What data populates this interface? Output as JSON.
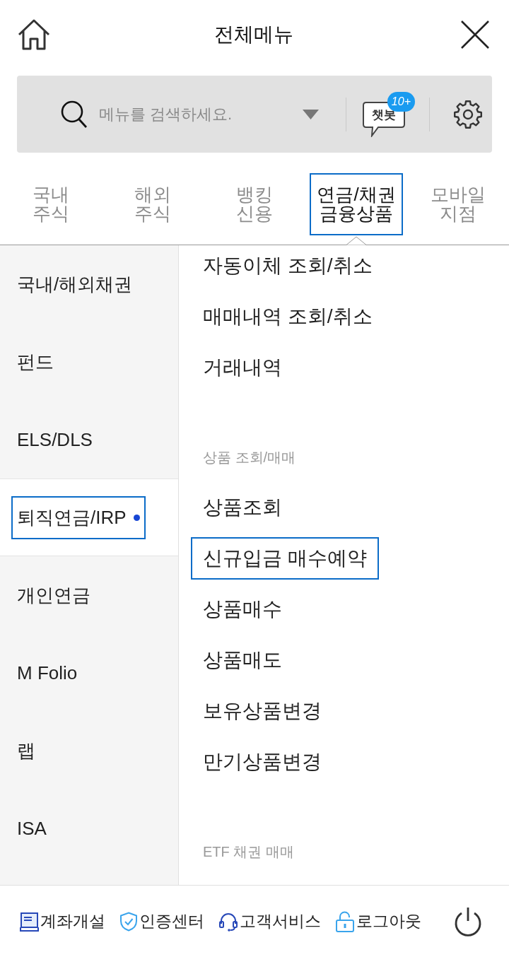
{
  "header": {
    "title": "전체메뉴"
  },
  "search": {
    "placeholder": "메뉴를 검색하세요.",
    "chatbot": {
      "label": "챗봇",
      "badge": "10+"
    }
  },
  "tabs": [
    {
      "label": "국내\n주식",
      "selected": false,
      "highlighted": false
    },
    {
      "label": "해외\n주식",
      "selected": false,
      "highlighted": false
    },
    {
      "label": "뱅킹\n신용",
      "selected": false,
      "highlighted": false
    },
    {
      "label": "연금/채권\n금융상품",
      "selected": true,
      "highlighted": true
    },
    {
      "label": "모바일\n지점",
      "selected": false,
      "highlighted": false
    }
  ],
  "sidebar": {
    "items": [
      {
        "label": "국내/해외채권",
        "selected": false,
        "highlighted": false,
        "marker": false
      },
      {
        "label": "펀드",
        "selected": false,
        "highlighted": false,
        "marker": false
      },
      {
        "label": "ELS/DLS",
        "selected": false,
        "highlighted": false,
        "marker": false
      },
      {
        "label": "퇴직연금/IRP",
        "selected": true,
        "highlighted": true,
        "marker": true
      },
      {
        "label": "개인연금",
        "selected": false,
        "highlighted": false,
        "marker": false
      },
      {
        "label": "M Folio",
        "selected": false,
        "highlighted": false,
        "marker": false
      },
      {
        "label": "랩",
        "selected": false,
        "highlighted": false,
        "marker": false
      },
      {
        "label": "ISA",
        "selected": false,
        "highlighted": false,
        "marker": false
      }
    ]
  },
  "menu": {
    "items": [
      {
        "kind": "item",
        "label": "자동이체 조회/취소",
        "highlighted": false
      },
      {
        "kind": "item",
        "label": "매매내역 조회/취소",
        "highlighted": false
      },
      {
        "kind": "item",
        "label": "거래내역",
        "highlighted": false
      },
      {
        "kind": "header",
        "label": "상품 조회/매매"
      },
      {
        "kind": "item",
        "label": "상품조회",
        "highlighted": false
      },
      {
        "kind": "item",
        "label": "신규입금 매수예약",
        "highlighted": true
      },
      {
        "kind": "item",
        "label": "상품매수",
        "highlighted": false
      },
      {
        "kind": "item",
        "label": "상품매도",
        "highlighted": false
      },
      {
        "kind": "item",
        "label": "보유상품변경",
        "highlighted": false
      },
      {
        "kind": "item",
        "label": "만기상품변경",
        "highlighted": false
      },
      {
        "kind": "header",
        "label": "ETF 채권 매매"
      }
    ]
  },
  "footer": {
    "links": [
      {
        "kind": "account",
        "label": "계좌개설"
      },
      {
        "kind": "certificate",
        "label": "인증센터"
      },
      {
        "kind": "support",
        "label": "고객서비스"
      },
      {
        "kind": "logout",
        "label": "로그아웃"
      }
    ]
  }
}
